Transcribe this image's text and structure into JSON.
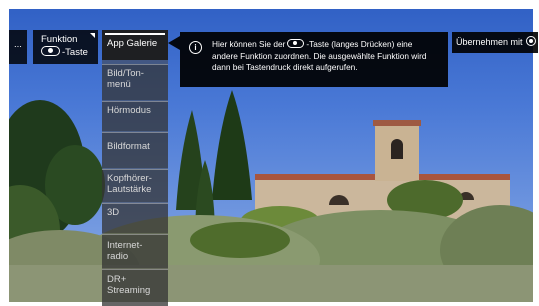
{
  "left_tiles": {
    "more_label": "...",
    "funktion_line1": "Funktion",
    "funktion_line2": "-Taste"
  },
  "menu": {
    "items": [
      {
        "label": "App Galerie",
        "selected": true
      },
      {
        "label": "Bild/Ton-menü"
      },
      {
        "label": "Hörmodus"
      },
      {
        "label": "Bildformat"
      },
      {
        "label": "Kopfhörer-Lautstärke"
      },
      {
        "label": "3D"
      },
      {
        "label": "Internet-radio"
      },
      {
        "label": "DR+ Streaming"
      }
    ]
  },
  "info": {
    "text_part1": "Hier können Sie der",
    "text_part2": "-Taste (langes Drücken) eine andere Funktion zuordnen. Die ausgewählte Funktion wird dann bei Tastendruck direkt aufgerufen."
  },
  "apply": {
    "label": "Übernehmen mit"
  },
  "icons": [
    "info-icon",
    "key-pill-icon",
    "ok-icon",
    "corner-marker-icon"
  ],
  "colors": {
    "sky": "#3f6fd0",
    "panel": "#000000",
    "text": "#ffffff"
  }
}
